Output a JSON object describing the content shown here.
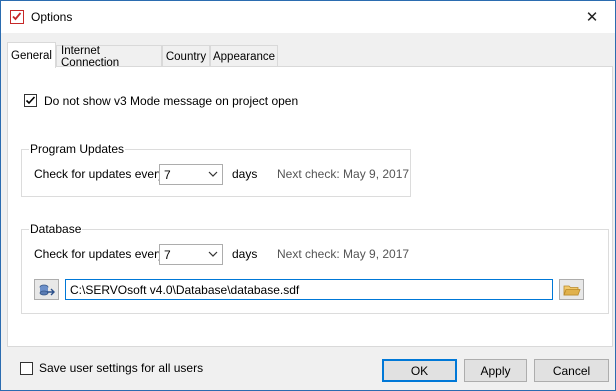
{
  "window": {
    "title": "Options",
    "close_glyph": "✕"
  },
  "tabs": [
    {
      "label": "General"
    },
    {
      "label": "Internet Connection"
    },
    {
      "label": "Country"
    },
    {
      "label": "Appearance"
    }
  ],
  "general": {
    "v3_message_label": "Do not show v3 Mode message on project open",
    "v3_message_checked": true
  },
  "program_updates": {
    "title": "Program Updates",
    "check_label": "Check for updates every",
    "interval": "7",
    "unit": "days",
    "next_check": "Next check: May 9, 2017"
  },
  "database": {
    "title": "Database",
    "check_label": "Check for updates every",
    "interval": "7",
    "unit": "days",
    "next_check": "Next check: May 9, 2017",
    "path": "C:\\SERVOsoft v4.0\\Database\\database.sdf"
  },
  "footer": {
    "save_all_label": "Save user settings for all users",
    "save_all_checked": false,
    "ok_label": "OK",
    "apply_label": "Apply",
    "cancel_label": "Cancel"
  },
  "colors": {
    "accent": "#0078d7",
    "app_icon": "#c62828",
    "folder": "#e0b14c"
  }
}
